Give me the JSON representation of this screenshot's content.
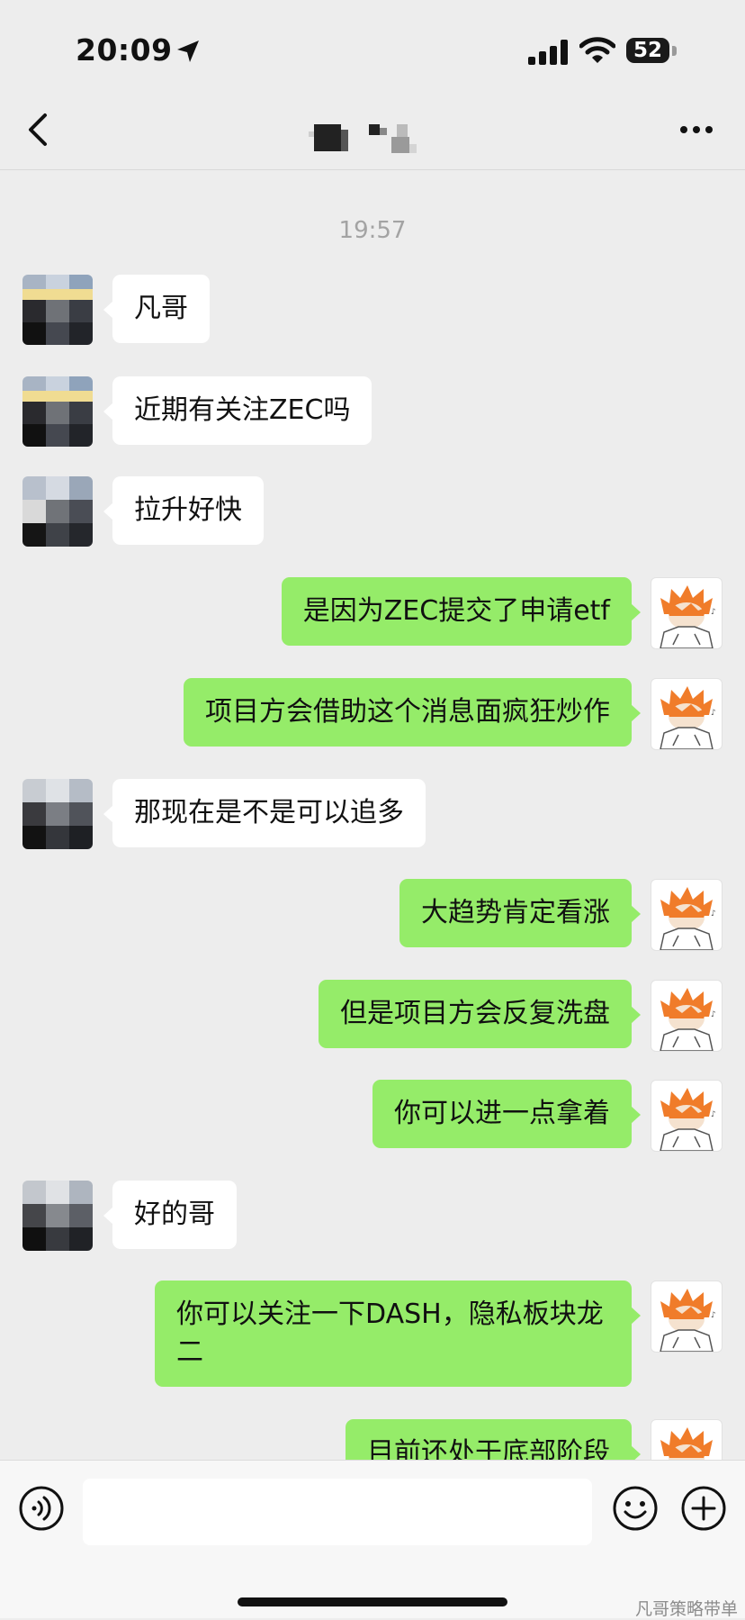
{
  "status_bar": {
    "time": "20:09",
    "battery": "52"
  },
  "header": {
    "contact_name": ""
  },
  "chat": {
    "timestamp": "19:57",
    "messages": [
      {
        "side": "in",
        "text": "凡哥"
      },
      {
        "side": "in",
        "text": "近期有关注ZEC吗"
      },
      {
        "side": "in",
        "text": "拉升好快"
      },
      {
        "side": "out",
        "text": "是因为ZEC提交了申请etf"
      },
      {
        "side": "out",
        "text": "项目方会借助这个消息面疯狂炒作"
      },
      {
        "side": "in",
        "text": "那现在是不是可以追多"
      },
      {
        "side": "out",
        "text": "大趋势肯定看涨"
      },
      {
        "side": "out",
        "text": "但是项目方会反复洗盘"
      },
      {
        "side": "out",
        "text": "你可以进一点拿着"
      },
      {
        "side": "in",
        "text": "好的哥"
      },
      {
        "side": "out",
        "text": "你可以关注一下DASH，隐私板块龙二"
      },
      {
        "side": "out",
        "text": "目前还处于底部阶段"
      }
    ]
  },
  "input_bar": {
    "message_value": ""
  },
  "watermark": "凡哥策略带单",
  "colors": {
    "background": "#ededed",
    "outgoing_bubble": "#95ec69",
    "incoming_bubble": "#ffffff"
  },
  "icons": {
    "status": [
      "location-arrow-icon",
      "signal-icon",
      "wifi-icon",
      "battery-icon"
    ],
    "nav": [
      "back-chevron-icon",
      "more-icon"
    ],
    "input": [
      "voice-icon",
      "emoji-icon",
      "plus-icon"
    ]
  }
}
